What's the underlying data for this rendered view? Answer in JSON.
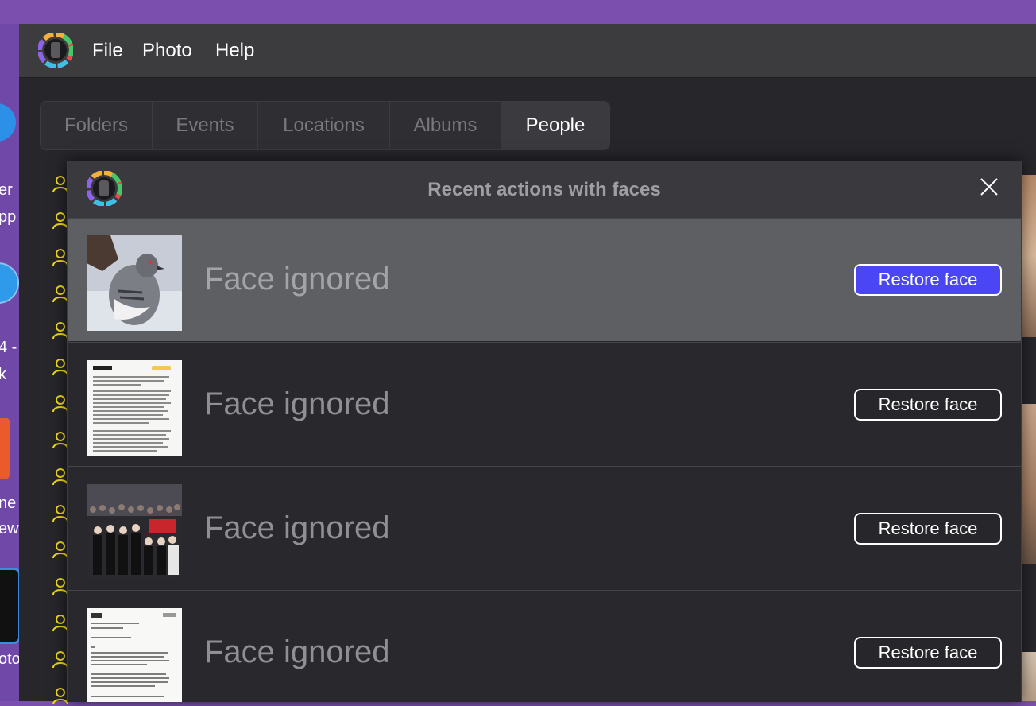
{
  "menubar": {
    "items": [
      "File",
      "Photo",
      "Help"
    ]
  },
  "tabs": [
    {
      "label": "Folders",
      "active": false
    },
    {
      "label": "Events",
      "active": false
    },
    {
      "label": "Locations",
      "active": false
    },
    {
      "label": "Albums",
      "active": false
    },
    {
      "label": "People",
      "active": true
    }
  ],
  "desktop": {
    "labels": [
      "er",
      "pp",
      "4 -",
      "k",
      "ne",
      "ew",
      "oto"
    ]
  },
  "dialog": {
    "title": "Recent actions with faces",
    "close_icon": "close-icon",
    "rows": [
      {
        "status": "Face ignored",
        "button": "Restore face",
        "thumbnail": "pigeon-photo",
        "highlighted": true
      },
      {
        "status": "Face ignored",
        "button": "Restore face",
        "thumbnail": "document-screenshot",
        "highlighted": false
      },
      {
        "status": "Face ignored",
        "button": "Restore face",
        "thumbnail": "crowd-photo",
        "highlighted": false
      },
      {
        "status": "Face ignored",
        "button": "Restore face",
        "thumbnail": "text-screenshot",
        "highlighted": false
      }
    ]
  },
  "colors": {
    "accent_button": "#4a45f5",
    "desktop_bg": "#7a4fae",
    "person_icon": "#f2dc1f"
  }
}
